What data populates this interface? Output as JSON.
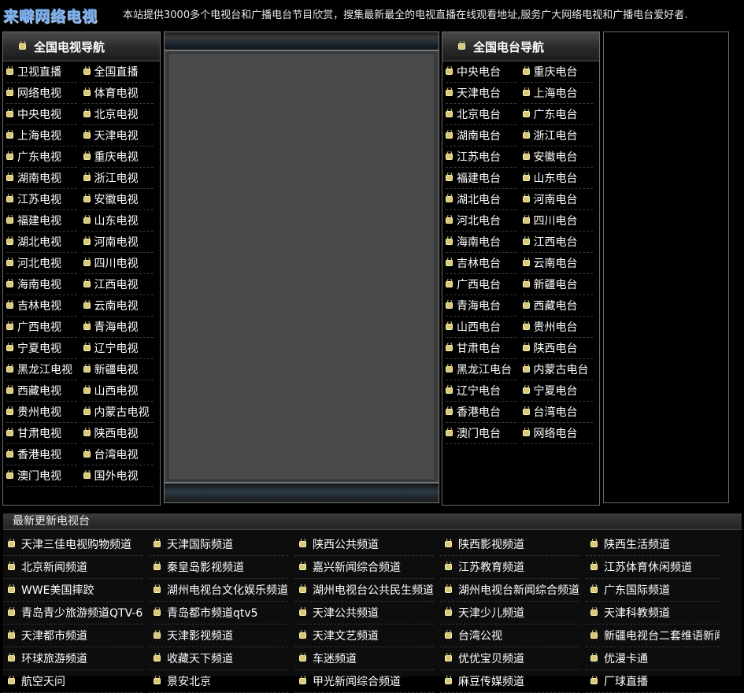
{
  "site": {
    "logo": "来噼网络电视",
    "intro": "本站提供3000多个电视台和广播电台节目欣赏，搜集最新最全的电视直播在线观看地址,服务广大网络电视和广播电台爱好者."
  },
  "tv_nav": {
    "title": "全国电视导航",
    "items": [
      "卫视直播",
      "全国直播",
      "网络电视",
      "体育电视",
      "中央电视",
      "北京电视",
      "上海电视",
      "天津电视",
      "广东电视",
      "重庆电视",
      "湖南电视",
      "浙江电视",
      "江苏电视",
      "安徽电视",
      "福建电视",
      "山东电视",
      "湖北电视",
      "河南电视",
      "河北电视",
      "四川电视",
      "海南电视",
      "江西电视",
      "吉林电视",
      "云南电视",
      "广西电视",
      "青海电视",
      "宁夏电视",
      "辽宁电视",
      "黑龙江电视",
      "新疆电视",
      "西藏电视",
      "山西电视",
      "贵州电视",
      "内蒙古电视",
      "甘肃电视",
      "陕西电视",
      "香港电视",
      "台湾电视",
      "澳门电视",
      "国外电视"
    ]
  },
  "radio_nav": {
    "title": "全国电台导航",
    "items": [
      "中央电台",
      "重庆电台",
      "天津电台",
      "上海电台",
      "北京电台",
      "广东电台",
      "湖南电台",
      "浙江电台",
      "江苏电台",
      "安徽电台",
      "福建电台",
      "山东电台",
      "湖北电台",
      "河南电台",
      "河北电台",
      "四川电台",
      "海南电台",
      "江西电台",
      "吉林电台",
      "云南电台",
      "广西电台",
      "新疆电台",
      "青海电台",
      "西藏电台",
      "山西电台",
      "贵州电台",
      "甘肃电台",
      "陕西电台",
      "黑龙江电台",
      "内蒙古电台",
      "辽宁电台",
      "宁夏电台",
      "香港电台",
      "台湾电台",
      "澳门电台",
      "网络电台"
    ]
  },
  "latest": {
    "title": "最新更新电视台",
    "items": [
      "天津三佳电视购物频道",
      "天津国际频道",
      "陕西公共频道",
      "陕西影视频道",
      "陕西生活频道",
      "北京新闻频道",
      "秦皇岛影视频道",
      "嘉兴新闻综合频道",
      "江苏教育频道",
      "江苏体育休闲频道",
      "WWE美国摔跤",
      "湖州电视台文化娱乐频道",
      "湖州电视台公共民生频道",
      "湖州电视台新闻综合频道",
      "广东国际频道",
      "青岛青少旅游频道QTV-6",
      "青岛都市频道qtv5",
      "天津公共频道",
      "天津少儿频道",
      "天津科教频道",
      "天津都市频道",
      "天津影视频道",
      "天津文艺频道",
      "台湾公视",
      "新疆电视台二套维语新闻综合",
      "环球旅游频道",
      "收藏天下频道",
      "车迷频道",
      "优优宝贝频道",
      "优漫卡通",
      "航空天问",
      "景安北京",
      "甲光新闻综合频道",
      "麻豆传媒频道",
      "厂球直播"
    ]
  }
}
